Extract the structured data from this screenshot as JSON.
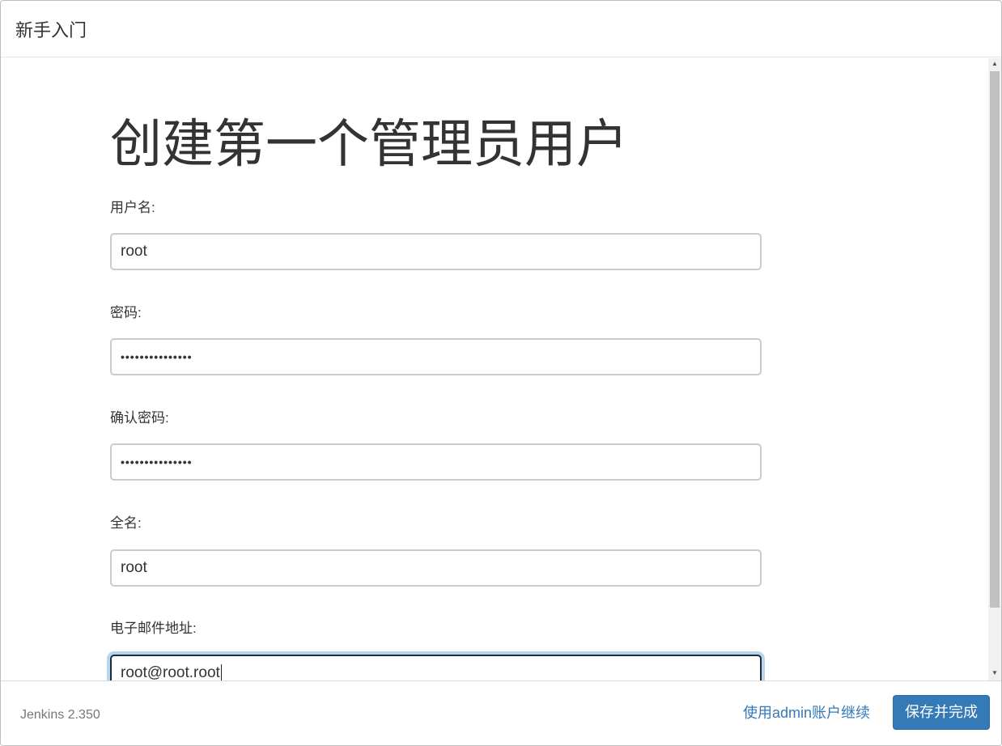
{
  "header": {
    "title": "新手入门"
  },
  "main": {
    "heading": "创建第一个管理员用户",
    "fields": {
      "username": {
        "label": "用户名:",
        "value": "root"
      },
      "password": {
        "label": "密码:",
        "value": "•••••••••••••••"
      },
      "confirm_password": {
        "label": "确认密码:",
        "value": "•••••••••••••••"
      },
      "fullname": {
        "label": "全名:",
        "value": "root"
      },
      "email": {
        "label": "电子邮件地址:",
        "value": "root@root.root"
      }
    }
  },
  "footer": {
    "version": "Jenkins 2.350",
    "continue_link": "使用admin账户继续",
    "save_button": "保存并完成"
  },
  "colors": {
    "primary": "#337ab7",
    "focus_ring": "#b9d5ec"
  }
}
